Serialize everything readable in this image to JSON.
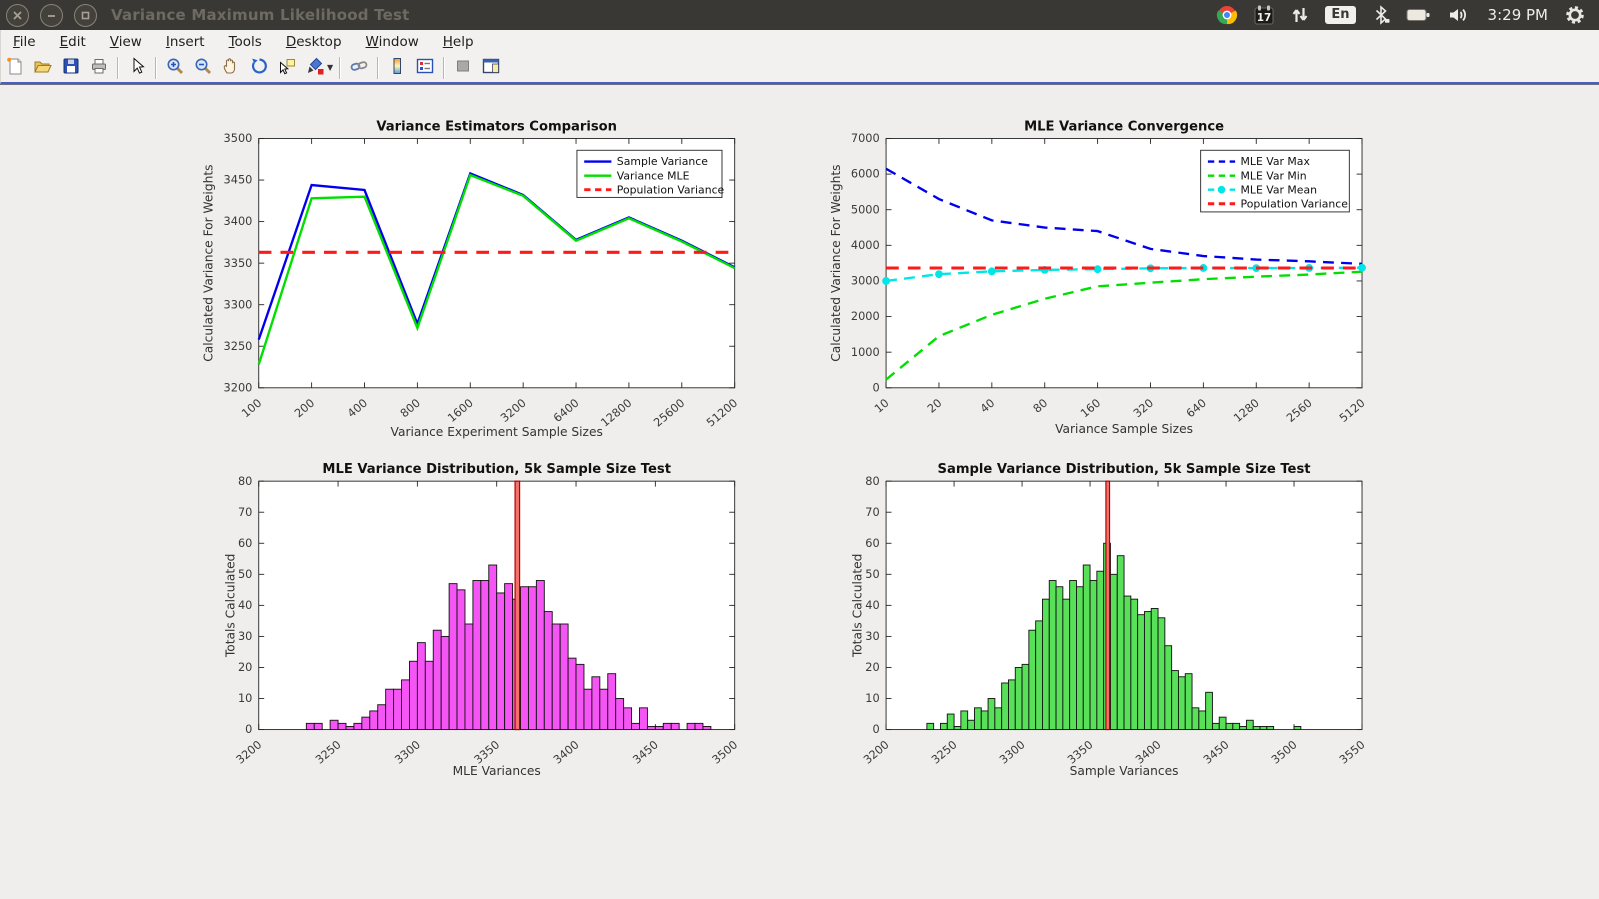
{
  "window": {
    "title": "Variance Maximum Likelihood Test",
    "controls": [
      "close",
      "minimize",
      "maximize"
    ]
  },
  "system_tray": {
    "calendar_day": "17",
    "keyboard_layout": "En",
    "clock": "3:29 PM",
    "icons": [
      "chrome",
      "calendar",
      "network-arrows",
      "keyboard-layout",
      "bluetooth-lock",
      "battery",
      "volume",
      "clock",
      "settings-gear"
    ]
  },
  "menubar": {
    "items": [
      "File",
      "Edit",
      "View",
      "Insert",
      "Tools",
      "Desktop",
      "Window",
      "Help"
    ]
  },
  "toolbar": {
    "icons": [
      "new-file",
      "open-file",
      "save",
      "print",
      "pointer",
      "zoom-in",
      "zoom-out",
      "pan-hand",
      "rotate-3d",
      "data-cursor",
      "brush",
      "brush-dropdown",
      "link-plots",
      "insert-colorbar",
      "insert-legend",
      "hide-plot-tools",
      "show-plot-tools"
    ]
  },
  "colors": {
    "titlebar_bg": "#3A3834",
    "canvas_bg": "#EFEEEC",
    "axes_bg": "#FFFFFF",
    "axis_line": "#262626",
    "blue_series": "#0000EE",
    "green_series": "#00DF00",
    "red_series": "#FF1A1A",
    "cyan_series": "#00E5E5",
    "magenta_bars": "#F455F4",
    "green_bars": "#58E058",
    "vline_fill": "#F4716B",
    "vline_edge": "#B00000"
  },
  "chart_data": [
    {
      "type": "line",
      "title": "Variance Estimators Comparison",
      "xlabel": "Variance Experiment Sample Sizes",
      "ylabel": "Calculated Variance For Weights",
      "categories": [
        "100",
        "200",
        "400",
        "800",
        "1600",
        "3200",
        "6400",
        "12800",
        "25600",
        "51200"
      ],
      "ylim": [
        3200,
        3500
      ],
      "ytick_step": 50,
      "grid": false,
      "legend_position": "top-right",
      "series": [
        {
          "name": "Sample Variance",
          "color": "#0000EE",
          "style": "solid",
          "values": [
            3258,
            3444,
            3438,
            3277,
            3458,
            3432,
            3378,
            3405,
            3377,
            3345
          ]
        },
        {
          "name": "Variance MLE",
          "color": "#00DF00",
          "style": "solid",
          "values": [
            3228,
            3428,
            3430,
            3272,
            3456,
            3431,
            3377,
            3404,
            3376,
            3344
          ]
        },
        {
          "name": "Population Variance",
          "color": "#FF1A1A",
          "style": "dashed",
          "values": [
            3363,
            3363,
            3363,
            3363,
            3363,
            3363,
            3363,
            3363,
            3363,
            3363
          ]
        }
      ]
    },
    {
      "type": "line",
      "title": "MLE Variance Convergence",
      "xlabel": "Variance Sample Sizes",
      "ylabel": "Calculated Variance For Weights",
      "categories": [
        "10",
        "20",
        "40",
        "80",
        "160",
        "320",
        "640",
        "1280",
        "2560",
        "5120"
      ],
      "ylim": [
        0,
        7000
      ],
      "ytick_step": 1000,
      "grid": false,
      "legend_position": "top-right",
      "series": [
        {
          "name": "MLE Var Max",
          "color": "#0000EE",
          "style": "dashed",
          "values": [
            6150,
            5300,
            4700,
            4500,
            4400,
            3900,
            3700,
            3600,
            3550,
            3480
          ]
        },
        {
          "name": "MLE Var Min",
          "color": "#00DF00",
          "style": "dashed",
          "values": [
            230,
            1450,
            2050,
            2500,
            2850,
            2950,
            3050,
            3120,
            3180,
            3260
          ]
        },
        {
          "name": "MLE Var Mean",
          "color": "#00E5E5",
          "style": "dashed",
          "marker": "circle",
          "values": [
            3000,
            3190,
            3270,
            3310,
            3330,
            3355,
            3365,
            3360,
            3365,
            3370
          ]
        },
        {
          "name": "Population Variance",
          "color": "#FF1A1A",
          "style": "dashed",
          "values": [
            3363,
            3363,
            3363,
            3363,
            3363,
            3363,
            3363,
            3363,
            3363,
            3363
          ]
        }
      ]
    },
    {
      "type": "bar",
      "title": "MLE Variance Distribution, 5k Sample Size Test",
      "xlabel": "MLE Variances",
      "ylabel": "Totals Calculated",
      "xlim": [
        3200,
        3500
      ],
      "ylim": [
        0,
        80
      ],
      "xtick_step": 50,
      "ytick_step": 10,
      "bin_start": 3230,
      "bin_width": 5,
      "bar_color": "#F455F4",
      "bar_edge": "#111111",
      "values": [
        2,
        2,
        0,
        3,
        2,
        1,
        2,
        4,
        6,
        8,
        13,
        13,
        16,
        22,
        28,
        22,
        32,
        30,
        47,
        45,
        34,
        48,
        48,
        53,
        44,
        47,
        42,
        46,
        46,
        48,
        38,
        34,
        34,
        23,
        21,
        13,
        17,
        13,
        18,
        10,
        7,
        2,
        7,
        1,
        1,
        2,
        2,
        0,
        2,
        2,
        1
      ],
      "vline": {
        "x": 3363,
        "color": "#F4716B",
        "edge": "#B00000"
      }
    },
    {
      "type": "bar",
      "title": "Sample Variance Distribution, 5k Sample Size Test",
      "xlabel": "Sample Variances",
      "ylabel": "Totals Calculated",
      "xlim": [
        3200,
        3550
      ],
      "ylim": [
        0,
        80
      ],
      "xtick_step": 50,
      "ytick_step": 10,
      "bin_start": 3230,
      "bin_width": 5,
      "bar_color": "#58E058",
      "bar_edge": "#111111",
      "values": [
        2,
        0,
        2,
        5,
        1,
        6,
        3,
        7,
        6,
        10,
        7,
        15,
        16,
        20,
        21,
        32,
        35,
        42,
        48,
        46,
        42,
        48,
        46,
        53,
        48,
        51,
        60,
        50,
        56,
        43,
        42,
        37,
        38,
        39,
        36,
        27,
        19,
        17,
        18,
        7,
        6,
        12,
        2,
        4,
        2,
        2,
        1,
        3,
        1,
        1,
        1,
        0,
        0,
        0,
        1
      ],
      "vline": {
        "x": 3363,
        "color": "#F4716B",
        "edge": "#B00000"
      }
    }
  ]
}
